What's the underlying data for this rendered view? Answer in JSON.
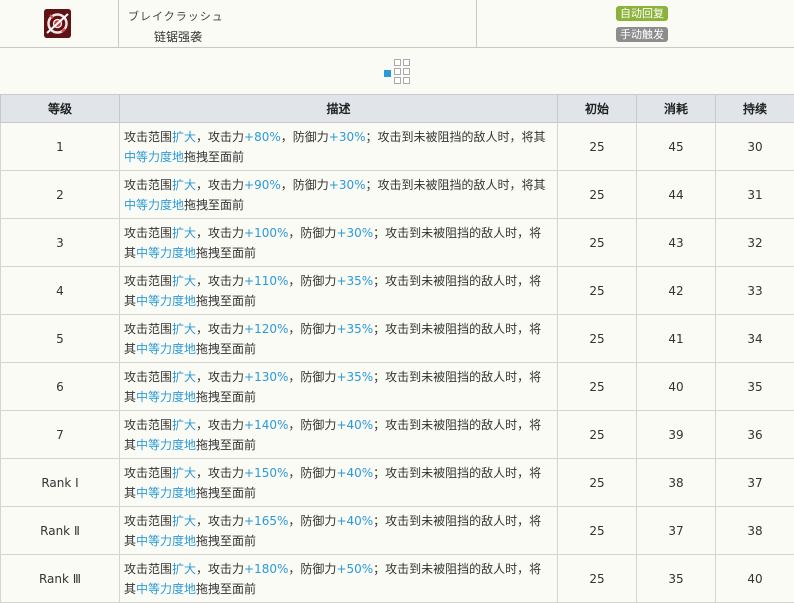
{
  "skill": {
    "icon": "chainsaw-skill-icon",
    "jp_name": "ブレイクラッシュ",
    "cn_name": "链锯强袭",
    "recovery_badge": "自动回复",
    "trigger_badge": "手动触发"
  },
  "range": {
    "icon": "attack-range-grid"
  },
  "table": {
    "headers": {
      "level": "等级",
      "description": "描述",
      "initial": "初始",
      "cost": "消耗",
      "duration": "持续"
    },
    "rows": [
      {
        "level": "1",
        "desc_parts": {
          "a": "攻击范围",
          "b": "扩大",
          "c": "，攻击力",
          "d": "+80%",
          "e": "，防御力",
          "f": "+30%",
          "g": "；攻击到未被阻挡的敌人时，将其",
          "h": "中等力度地",
          "i": "拖拽至面前"
        },
        "initial": "25",
        "cost": "45",
        "duration": "30"
      },
      {
        "level": "2",
        "desc_parts": {
          "a": "攻击范围",
          "b": "扩大",
          "c": "，攻击力",
          "d": "+90%",
          "e": "，防御力",
          "f": "+30%",
          "g": "；攻击到未被阻挡的敌人时，将其",
          "h": "中等力度地",
          "i": "拖拽至面前"
        },
        "initial": "25",
        "cost": "44",
        "duration": "31"
      },
      {
        "level": "3",
        "desc_parts": {
          "a": "攻击范围",
          "b": "扩大",
          "c": "，攻击力",
          "d": "+100%",
          "e": "，防御力",
          "f": "+30%",
          "g": "；攻击到未被阻挡的敌人时，将其",
          "h": "中等力度地",
          "i": "拖拽至面前"
        },
        "initial": "25",
        "cost": "43",
        "duration": "32"
      },
      {
        "level": "4",
        "desc_parts": {
          "a": "攻击范围",
          "b": "扩大",
          "c": "，攻击力",
          "d": "+110%",
          "e": "，防御力",
          "f": "+35%",
          "g": "；攻击到未被阻挡的敌人时，将其",
          "h": "中等力度地",
          "i": "拖拽至面前"
        },
        "initial": "25",
        "cost": "42",
        "duration": "33"
      },
      {
        "level": "5",
        "desc_parts": {
          "a": "攻击范围",
          "b": "扩大",
          "c": "，攻击力",
          "d": "+120%",
          "e": "，防御力",
          "f": "+35%",
          "g": "；攻击到未被阻挡的敌人时，将其",
          "h": "中等力度地",
          "i": "拖拽至面前"
        },
        "initial": "25",
        "cost": "41",
        "duration": "34"
      },
      {
        "level": "6",
        "desc_parts": {
          "a": "攻击范围",
          "b": "扩大",
          "c": "，攻击力",
          "d": "+130%",
          "e": "，防御力",
          "f": "+35%",
          "g": "；攻击到未被阻挡的敌人时，将其",
          "h": "中等力度地",
          "i": "拖拽至面前"
        },
        "initial": "25",
        "cost": "40",
        "duration": "35"
      },
      {
        "level": "7",
        "desc_parts": {
          "a": "攻击范围",
          "b": "扩大",
          "c": "，攻击力",
          "d": "+140%",
          "e": "，防御力",
          "f": "+40%",
          "g": "；攻击到未被阻挡的敌人时，将其",
          "h": "中等力度地",
          "i": "拖拽至面前"
        },
        "initial": "25",
        "cost": "39",
        "duration": "36"
      },
      {
        "level": "Rank Ⅰ",
        "desc_parts": {
          "a": "攻击范围",
          "b": "扩大",
          "c": "，攻击力",
          "d": "+150%",
          "e": "，防御力",
          "f": "+40%",
          "g": "；攻击到未被阻挡的敌人时，将其",
          "h": "中等力度地",
          "i": "拖拽至面前"
        },
        "initial": "25",
        "cost": "38",
        "duration": "37"
      },
      {
        "level": "Rank Ⅱ",
        "desc_parts": {
          "a": "攻击范围",
          "b": "扩大",
          "c": "，攻击力",
          "d": "+165%",
          "e": "，防御力",
          "f": "+40%",
          "g": "；攻击到未被阻挡的敌人时，将其",
          "h": "中等力度地",
          "i": "拖拽至面前"
        },
        "initial": "25",
        "cost": "37",
        "duration": "38"
      },
      {
        "level": "Rank Ⅲ",
        "desc_parts": {
          "a": "攻击范围",
          "b": "扩大",
          "c": "，攻击力",
          "d": "+180%",
          "e": "，防御力",
          "f": "+50%",
          "g": "；攻击到未被阻挡的敌人时，将其",
          "h": "中等力度地",
          "i": "拖拽至面前"
        },
        "initial": "25",
        "cost": "35",
        "duration": "40"
      }
    ]
  }
}
